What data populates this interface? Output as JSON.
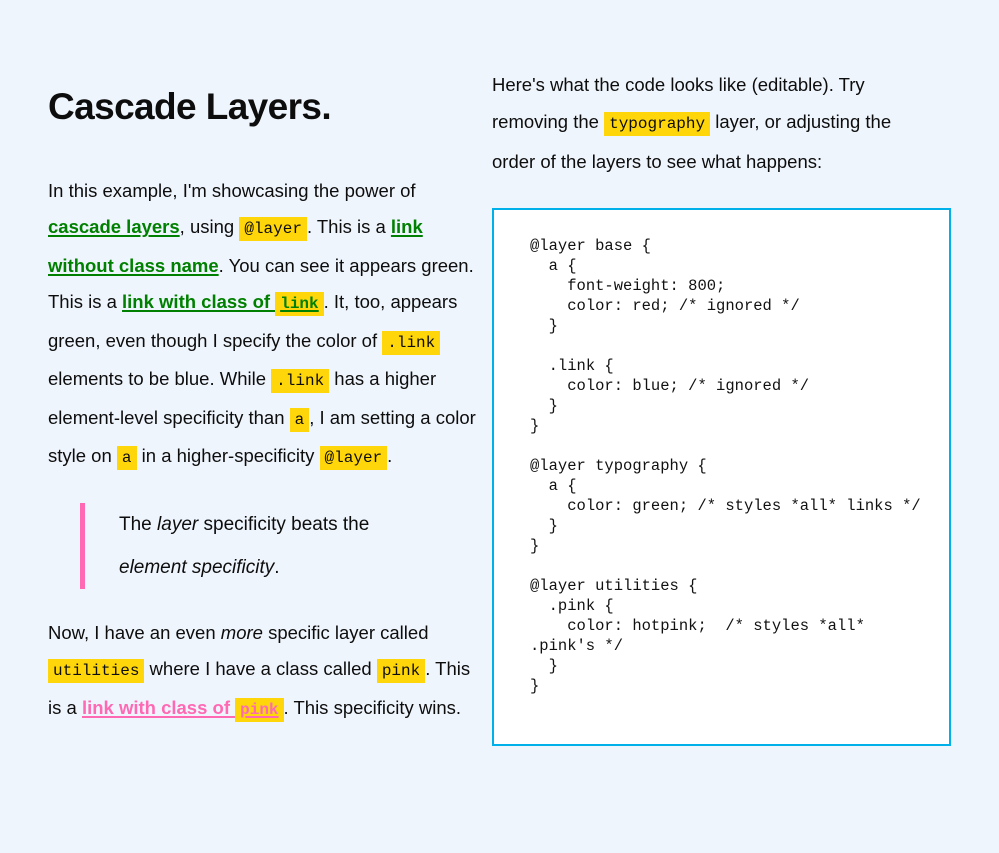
{
  "page": {
    "background_color": "#eff5fd",
    "text_color": "#0d0d0d"
  },
  "colors": {
    "link_green": "#008000",
    "link_pink": "#ff69b4",
    "code_highlight": "#ffd60a",
    "code_border": "#00b0e8",
    "code_background": "#ffffff"
  },
  "left": {
    "title": "Cascade Layers.",
    "paragraph1": {
      "t1": "In this example, I'm showcasing the power of ",
      "link_cascade_layers": "cascade layers",
      "t2": ", using ",
      "code_at_layer_1": "@layer",
      "t3": ". This is a ",
      "link_without_class": "link without class name",
      "t4": ". You can see it appears green. This is a ",
      "link_with_class_of": "link with class of ",
      "code_link_inline": "link",
      "t5": ". It, too, appears green, even though I specify the color of ",
      "code_dot_link_1": ".link",
      "t6": " elements to be blue. While ",
      "code_dot_link_2": ".link",
      "t7": " has a higher element-level specificity than ",
      "code_a_1": "a",
      "t8": ", I am setting a color style on ",
      "code_a_2": "a",
      "t9": " in a higher-specificity ",
      "code_at_layer_2": "@layer",
      "t10": "."
    },
    "blockquote": {
      "t1": "The ",
      "em1": "layer",
      "t2": " specificity beats the ",
      "em2": "element specificity",
      "t3": "."
    },
    "paragraph2": {
      "t1": "Now, I have an even ",
      "em1": "more",
      "t2": " specific layer called ",
      "code_utilities": "utilities",
      "t3": " where I have a class called ",
      "code_pink_1": "pink",
      "t4": ". This is a ",
      "link_with_class_of": "link with class of ",
      "code_pink_2": "pink",
      "t5": ". This specificity wins."
    }
  },
  "right": {
    "intro": {
      "t1": "Here's what the code looks like (editable). Try removing the ",
      "code_typography": "typography",
      "t2": " layer, or adjusting the order of the layers to see what happens:"
    },
    "code": "@layer base {\n  a {\n    font-weight: 800;\n    color: red; /* ignored */\n  }\n\n  .link {\n    color: blue; /* ignored */\n  }\n}\n\n@layer typography {\n  a {\n    color: green; /* styles *all* links */\n  }\n}\n\n@layer utilities {\n  .pink {\n    color: hotpink;  /* styles *all* .pink's */\n  }\n}"
  }
}
